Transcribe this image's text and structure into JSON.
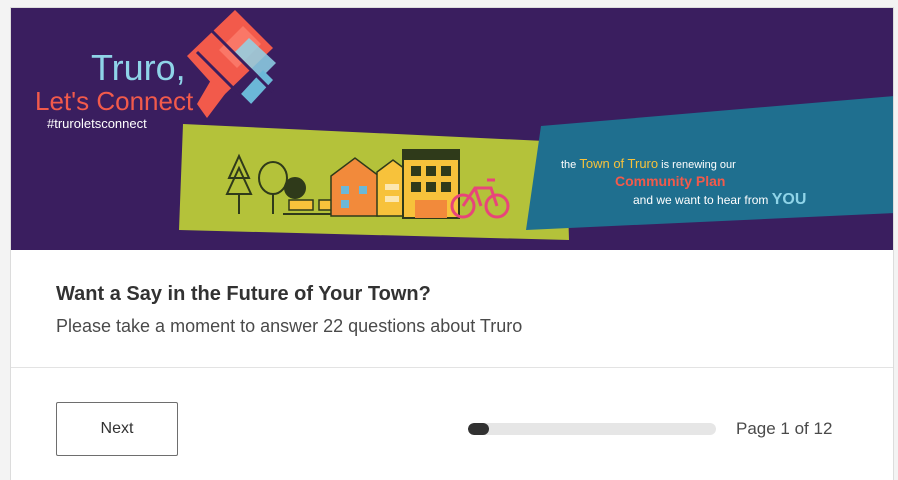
{
  "banner": {
    "logo_text_1": "Truro,",
    "logo_text_2": "Let's Connect",
    "hashtag": "#truroletsconnect",
    "tagline_part1": "the ",
    "tagline_town": "Town of Truro",
    "tagline_part2": " is renewing our",
    "tagline_plan": "Community Plan",
    "tagline_part3": "and we want to hear from ",
    "tagline_you": "YOU"
  },
  "survey": {
    "title": "Want a Say in the Future of Your Town?",
    "description": "Please take a moment to answer 22 questions about Truro"
  },
  "footer": {
    "next_label": "Next",
    "page_indicator": "Page 1 of 12",
    "progress_fraction": 0.083
  },
  "colors": {
    "banner_bg": "#3a1e5f",
    "accent_coral": "#f25a4b",
    "accent_teal": "#1f6f8f",
    "accent_lime": "#b4c23a",
    "logo_blue": "#8fd4e8"
  }
}
